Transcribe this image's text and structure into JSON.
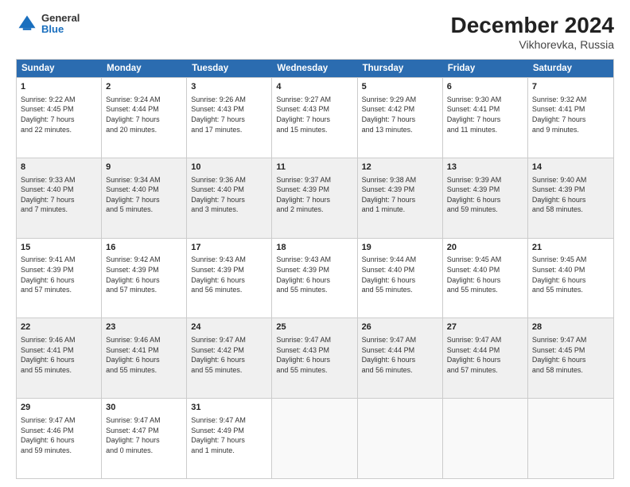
{
  "header": {
    "logo_general": "General",
    "logo_blue": "Blue",
    "title": "December 2024",
    "subtitle": "Vikhorevka, Russia"
  },
  "days_of_week": [
    "Sunday",
    "Monday",
    "Tuesday",
    "Wednesday",
    "Thursday",
    "Friday",
    "Saturday"
  ],
  "weeks": [
    [
      {
        "day": "1",
        "info": "Sunrise: 9:22 AM\nSunset: 4:45 PM\nDaylight: 7 hours\nand 22 minutes.",
        "shaded": false
      },
      {
        "day": "2",
        "info": "Sunrise: 9:24 AM\nSunset: 4:44 PM\nDaylight: 7 hours\nand 20 minutes.",
        "shaded": false
      },
      {
        "day": "3",
        "info": "Sunrise: 9:26 AM\nSunset: 4:43 PM\nDaylight: 7 hours\nand 17 minutes.",
        "shaded": false
      },
      {
        "day": "4",
        "info": "Sunrise: 9:27 AM\nSunset: 4:43 PM\nDaylight: 7 hours\nand 15 minutes.",
        "shaded": false
      },
      {
        "day": "5",
        "info": "Sunrise: 9:29 AM\nSunset: 4:42 PM\nDaylight: 7 hours\nand 13 minutes.",
        "shaded": false
      },
      {
        "day": "6",
        "info": "Sunrise: 9:30 AM\nSunset: 4:41 PM\nDaylight: 7 hours\nand 11 minutes.",
        "shaded": false
      },
      {
        "day": "7",
        "info": "Sunrise: 9:32 AM\nSunset: 4:41 PM\nDaylight: 7 hours\nand 9 minutes.",
        "shaded": false
      }
    ],
    [
      {
        "day": "8",
        "info": "Sunrise: 9:33 AM\nSunset: 4:40 PM\nDaylight: 7 hours\nand 7 minutes.",
        "shaded": true
      },
      {
        "day": "9",
        "info": "Sunrise: 9:34 AM\nSunset: 4:40 PM\nDaylight: 7 hours\nand 5 minutes.",
        "shaded": true
      },
      {
        "day": "10",
        "info": "Sunrise: 9:36 AM\nSunset: 4:40 PM\nDaylight: 7 hours\nand 3 minutes.",
        "shaded": true
      },
      {
        "day": "11",
        "info": "Sunrise: 9:37 AM\nSunset: 4:39 PM\nDaylight: 7 hours\nand 2 minutes.",
        "shaded": true
      },
      {
        "day": "12",
        "info": "Sunrise: 9:38 AM\nSunset: 4:39 PM\nDaylight: 7 hours\nand 1 minute.",
        "shaded": true
      },
      {
        "day": "13",
        "info": "Sunrise: 9:39 AM\nSunset: 4:39 PM\nDaylight: 6 hours\nand 59 minutes.",
        "shaded": true
      },
      {
        "day": "14",
        "info": "Sunrise: 9:40 AM\nSunset: 4:39 PM\nDaylight: 6 hours\nand 58 minutes.",
        "shaded": true
      }
    ],
    [
      {
        "day": "15",
        "info": "Sunrise: 9:41 AM\nSunset: 4:39 PM\nDaylight: 6 hours\nand 57 minutes.",
        "shaded": false
      },
      {
        "day": "16",
        "info": "Sunrise: 9:42 AM\nSunset: 4:39 PM\nDaylight: 6 hours\nand 57 minutes.",
        "shaded": false
      },
      {
        "day": "17",
        "info": "Sunrise: 9:43 AM\nSunset: 4:39 PM\nDaylight: 6 hours\nand 56 minutes.",
        "shaded": false
      },
      {
        "day": "18",
        "info": "Sunrise: 9:43 AM\nSunset: 4:39 PM\nDaylight: 6 hours\nand 55 minutes.",
        "shaded": false
      },
      {
        "day": "19",
        "info": "Sunrise: 9:44 AM\nSunset: 4:40 PM\nDaylight: 6 hours\nand 55 minutes.",
        "shaded": false
      },
      {
        "day": "20",
        "info": "Sunrise: 9:45 AM\nSunset: 4:40 PM\nDaylight: 6 hours\nand 55 minutes.",
        "shaded": false
      },
      {
        "day": "21",
        "info": "Sunrise: 9:45 AM\nSunset: 4:40 PM\nDaylight: 6 hours\nand 55 minutes.",
        "shaded": false
      }
    ],
    [
      {
        "day": "22",
        "info": "Sunrise: 9:46 AM\nSunset: 4:41 PM\nDaylight: 6 hours\nand 55 minutes.",
        "shaded": true
      },
      {
        "day": "23",
        "info": "Sunrise: 9:46 AM\nSunset: 4:41 PM\nDaylight: 6 hours\nand 55 minutes.",
        "shaded": true
      },
      {
        "day": "24",
        "info": "Sunrise: 9:47 AM\nSunset: 4:42 PM\nDaylight: 6 hours\nand 55 minutes.",
        "shaded": true
      },
      {
        "day": "25",
        "info": "Sunrise: 9:47 AM\nSunset: 4:43 PM\nDaylight: 6 hours\nand 55 minutes.",
        "shaded": true
      },
      {
        "day": "26",
        "info": "Sunrise: 9:47 AM\nSunset: 4:44 PM\nDaylight: 6 hours\nand 56 minutes.",
        "shaded": true
      },
      {
        "day": "27",
        "info": "Sunrise: 9:47 AM\nSunset: 4:44 PM\nDaylight: 6 hours\nand 57 minutes.",
        "shaded": true
      },
      {
        "day": "28",
        "info": "Sunrise: 9:47 AM\nSunset: 4:45 PM\nDaylight: 6 hours\nand 58 minutes.",
        "shaded": true
      }
    ],
    [
      {
        "day": "29",
        "info": "Sunrise: 9:47 AM\nSunset: 4:46 PM\nDaylight: 6 hours\nand 59 minutes.",
        "shaded": false
      },
      {
        "day": "30",
        "info": "Sunrise: 9:47 AM\nSunset: 4:47 PM\nDaylight: 7 hours\nand 0 minutes.",
        "shaded": false
      },
      {
        "day": "31",
        "info": "Sunrise: 9:47 AM\nSunset: 4:49 PM\nDaylight: 7 hours\nand 1 minute.",
        "shaded": false
      },
      {
        "day": "",
        "info": "",
        "shaded": false,
        "empty": true
      },
      {
        "day": "",
        "info": "",
        "shaded": false,
        "empty": true
      },
      {
        "day": "",
        "info": "",
        "shaded": false,
        "empty": true
      },
      {
        "day": "",
        "info": "",
        "shaded": false,
        "empty": true
      }
    ]
  ]
}
